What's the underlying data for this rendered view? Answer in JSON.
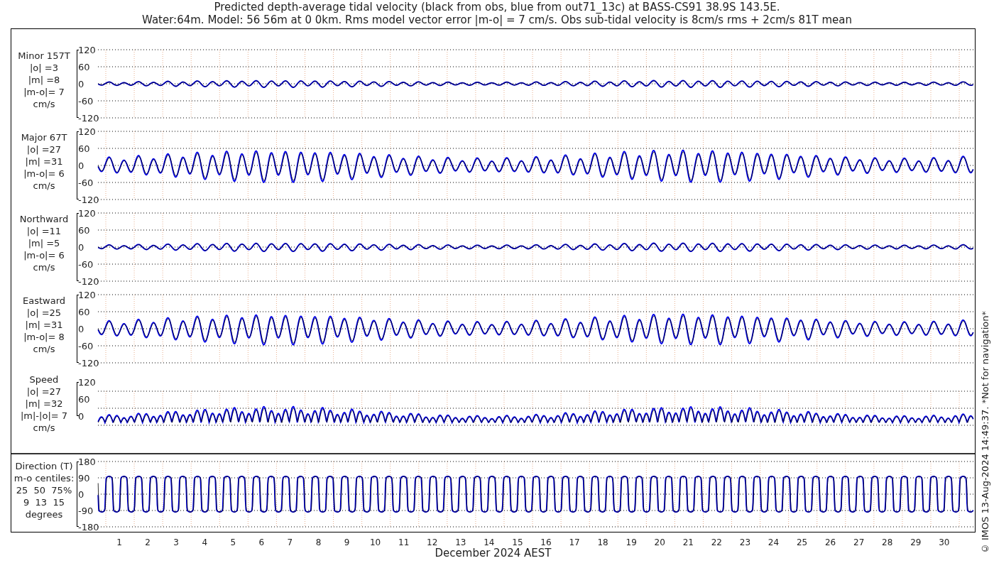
{
  "title_lines": [
    "Predicted depth-average tidal velocity (black from obs, blue from out71_13c) at BASS-CS91 38.9S 143.5E.",
    "Water:64m. Model: 56 56m at 0 0km. Rms model vector error |m-o| = 7 cm/s. Obs sub-tidal velocity is 8cm/s rms + 2cm/s 81T mean"
  ],
  "panels": [
    {
      "kind": "signed",
      "label_lines": [
        "Minor 157T",
        "|o| =3",
        "|m| =8",
        "|m-o|= 7",
        "cm/s"
      ],
      "y_ticks": [
        "120",
        "60",
        "0",
        "-60",
        "-120"
      ]
    },
    {
      "kind": "signed",
      "label_lines": [
        "Major 67T",
        "|o| =27",
        "|m| =31",
        "|m-o|= 6",
        "cm/s"
      ],
      "y_ticks": [
        "120",
        "60",
        "0",
        "-60",
        "-120"
      ]
    },
    {
      "kind": "signed",
      "label_lines": [
        "Northward",
        "|o| =11",
        "|m| =5",
        "|m-o|= 6",
        "cm/s"
      ],
      "y_ticks": [
        "120",
        "60",
        "0",
        "-60",
        "-120"
      ]
    },
    {
      "kind": "signed",
      "label_lines": [
        "Eastward",
        "|o| =25",
        "|m| =31",
        "|m-o|= 8",
        "cm/s"
      ],
      "y_ticks": [
        "120",
        "60",
        "0",
        "-60",
        "-120"
      ]
    },
    {
      "kind": "speed",
      "label_lines": [
        "Speed",
        "|o| =27",
        "|m| =32",
        "|m|-|o|= 7",
        "cm/s"
      ],
      "y_ticks": [
        "120",
        "60",
        "0"
      ]
    },
    {
      "kind": "direction",
      "label_lines": [
        "Direction (T)",
        "m-o centiles:",
        "25  50  75%",
        "9  13  15",
        "degrees"
      ],
      "y_ticks": [
        "180",
        "90",
        "0",
        "-90",
        "-180"
      ]
    }
  ],
  "x_axis": {
    "ticks": [
      "1",
      "2",
      "3",
      "4",
      "5",
      "6",
      "7",
      "8",
      "9",
      "10",
      "11",
      "12",
      "13",
      "14",
      "15",
      "16",
      "17",
      "18",
      "19",
      "20",
      "21",
      "22",
      "23",
      "24",
      "25",
      "26",
      "27",
      "28",
      "29",
      "30"
    ],
    "label": "December 2024 AEST"
  },
  "credit": "© IMOS 13-Aug-2024 14:49:37. *Not for navigation*"
}
